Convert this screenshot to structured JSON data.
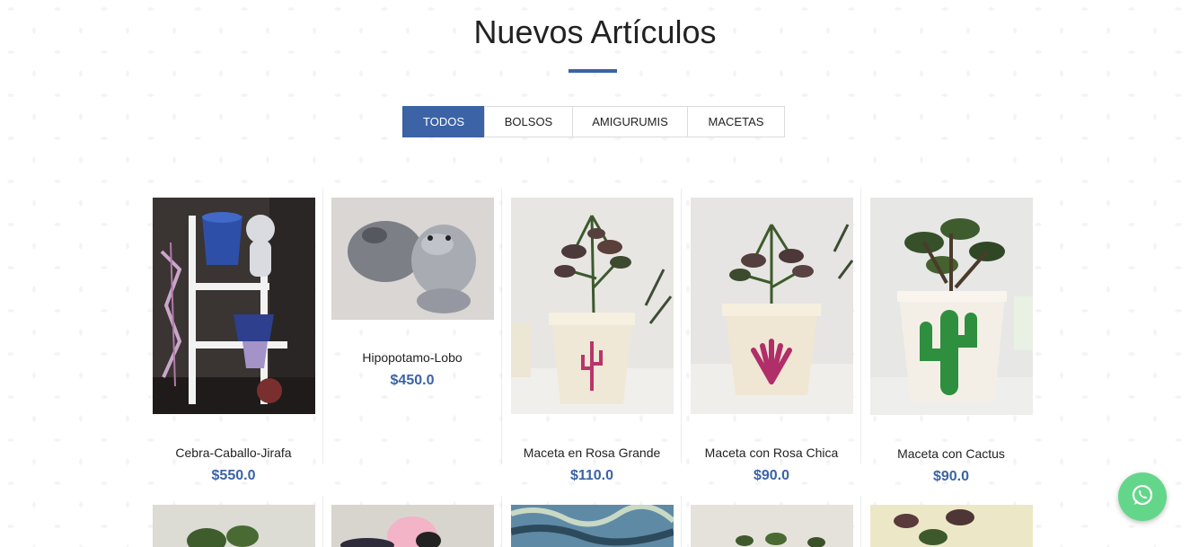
{
  "section": {
    "title": "Nuevos Artículos"
  },
  "filters": [
    {
      "label": "TODOS",
      "active": true
    },
    {
      "label": "BOLSOS",
      "active": false
    },
    {
      "label": "AMIGURUMIS",
      "active": false
    },
    {
      "label": "MACETAS",
      "active": false
    }
  ],
  "products": [
    {
      "name": "Cebra-Caballo-Jirafa",
      "price": "$550.0",
      "image": "amigurumi-shelf-photo"
    },
    {
      "name": "Hipopotamo-Lobo",
      "price": "$450.0",
      "image": "amigurumi-hippo-wolf-photo"
    },
    {
      "name": "Maceta en Rosa Grande",
      "price": "$110.0",
      "image": "pot-cactus-painted-photo"
    },
    {
      "name": "Maceta con Rosa Chica",
      "price": "$90.0",
      "image": "pot-shell-painted-photo"
    },
    {
      "name": "Maceta con Cactus",
      "price": "$90.0",
      "image": "pot-green-cactus-photo"
    }
  ],
  "colors": {
    "accent": "#3b63a6",
    "whatsapp": "#63d68a"
  },
  "whatsapp": {
    "icon": "whatsapp-icon"
  }
}
